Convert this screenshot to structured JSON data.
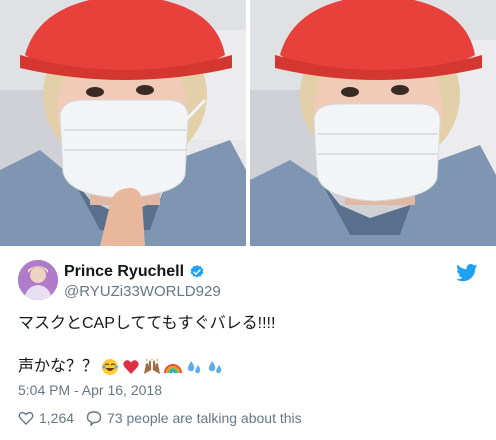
{
  "tweet": {
    "display_name": "Prince Ryuchell",
    "handle": "@RYUZi33WORLD929",
    "text_line1": "マスクとCAPしててもすぐバレる!!!!",
    "text_line2": "声かな？？",
    "timestamp": "5:04 PM - Apr 16, 2018",
    "likes": "1,264",
    "talking": "73 people are talking about this",
    "verified": true,
    "emojis": [
      "face-with-tears-of-joy",
      "red-heart",
      "raising-hands",
      "rainbow",
      "sweat-droplets",
      "sweat-droplets"
    ]
  },
  "colors": {
    "twitter_blue": "#1da1f2",
    "meta_gray": "#657786",
    "text": "#14171a",
    "cap_red": "#e8403a"
  },
  "icons": {
    "verified": "verified-badge-icon",
    "brand": "twitter-bird-icon",
    "like": "heart-outline-icon",
    "reply": "speech-bubble-icon"
  }
}
